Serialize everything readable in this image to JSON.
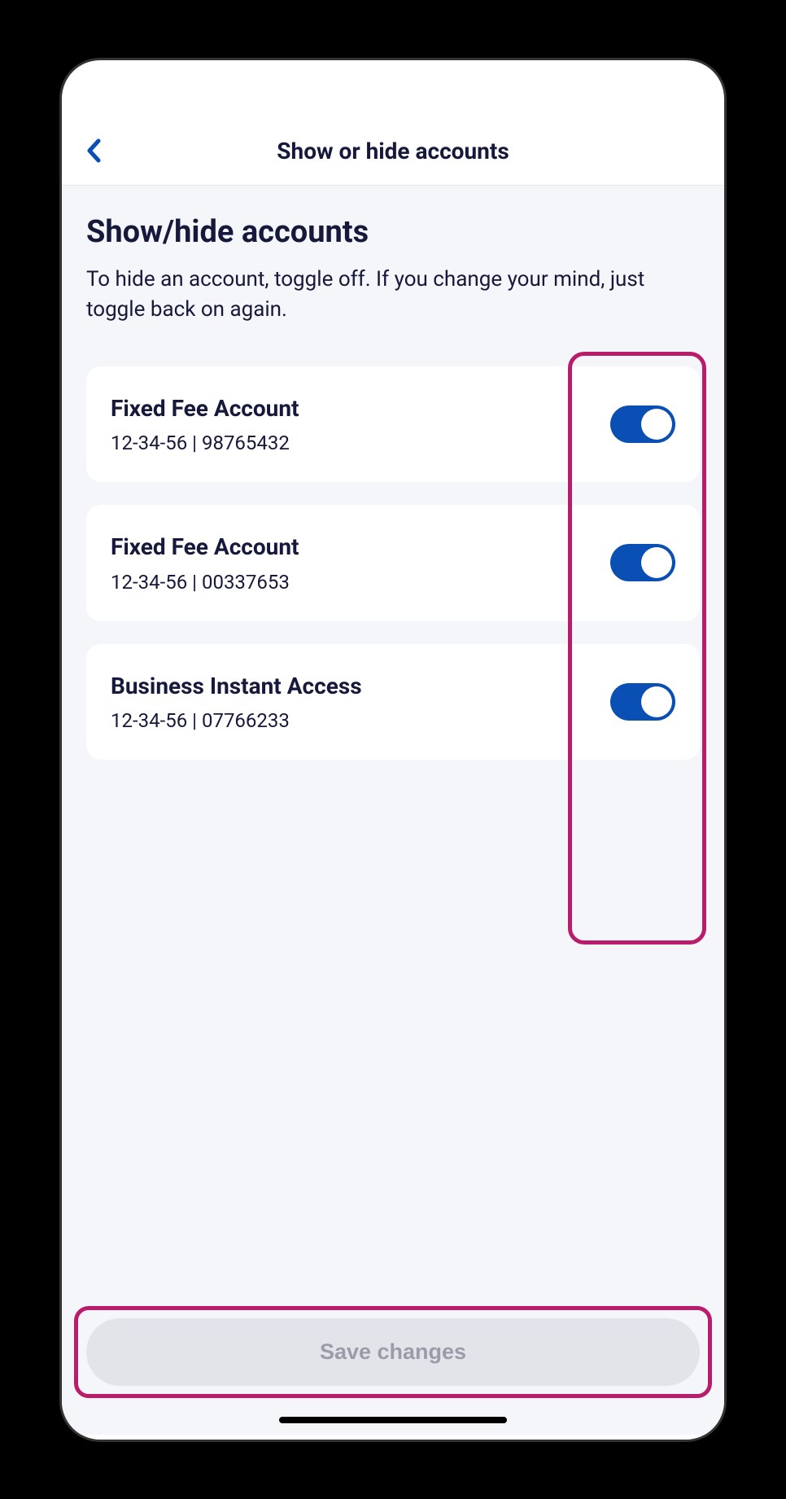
{
  "header": {
    "title": "Show or hide accounts"
  },
  "section": {
    "title": "Show/hide accounts",
    "description": "To hide an account, toggle off. If you change your mind, just toggle back on again."
  },
  "accounts": [
    {
      "name": "Fixed Fee Account",
      "details": "12-34-56 | 98765432",
      "enabled": true
    },
    {
      "name": "Fixed Fee Account",
      "details": "12-34-56 | 00337653",
      "enabled": true
    },
    {
      "name": "Business Instant Access",
      "details": "12-34-56 | 07766233",
      "enabled": true
    }
  ],
  "actions": {
    "save_label": "Save changes"
  },
  "annotations": {
    "highlight_color": "#b91c6b"
  }
}
